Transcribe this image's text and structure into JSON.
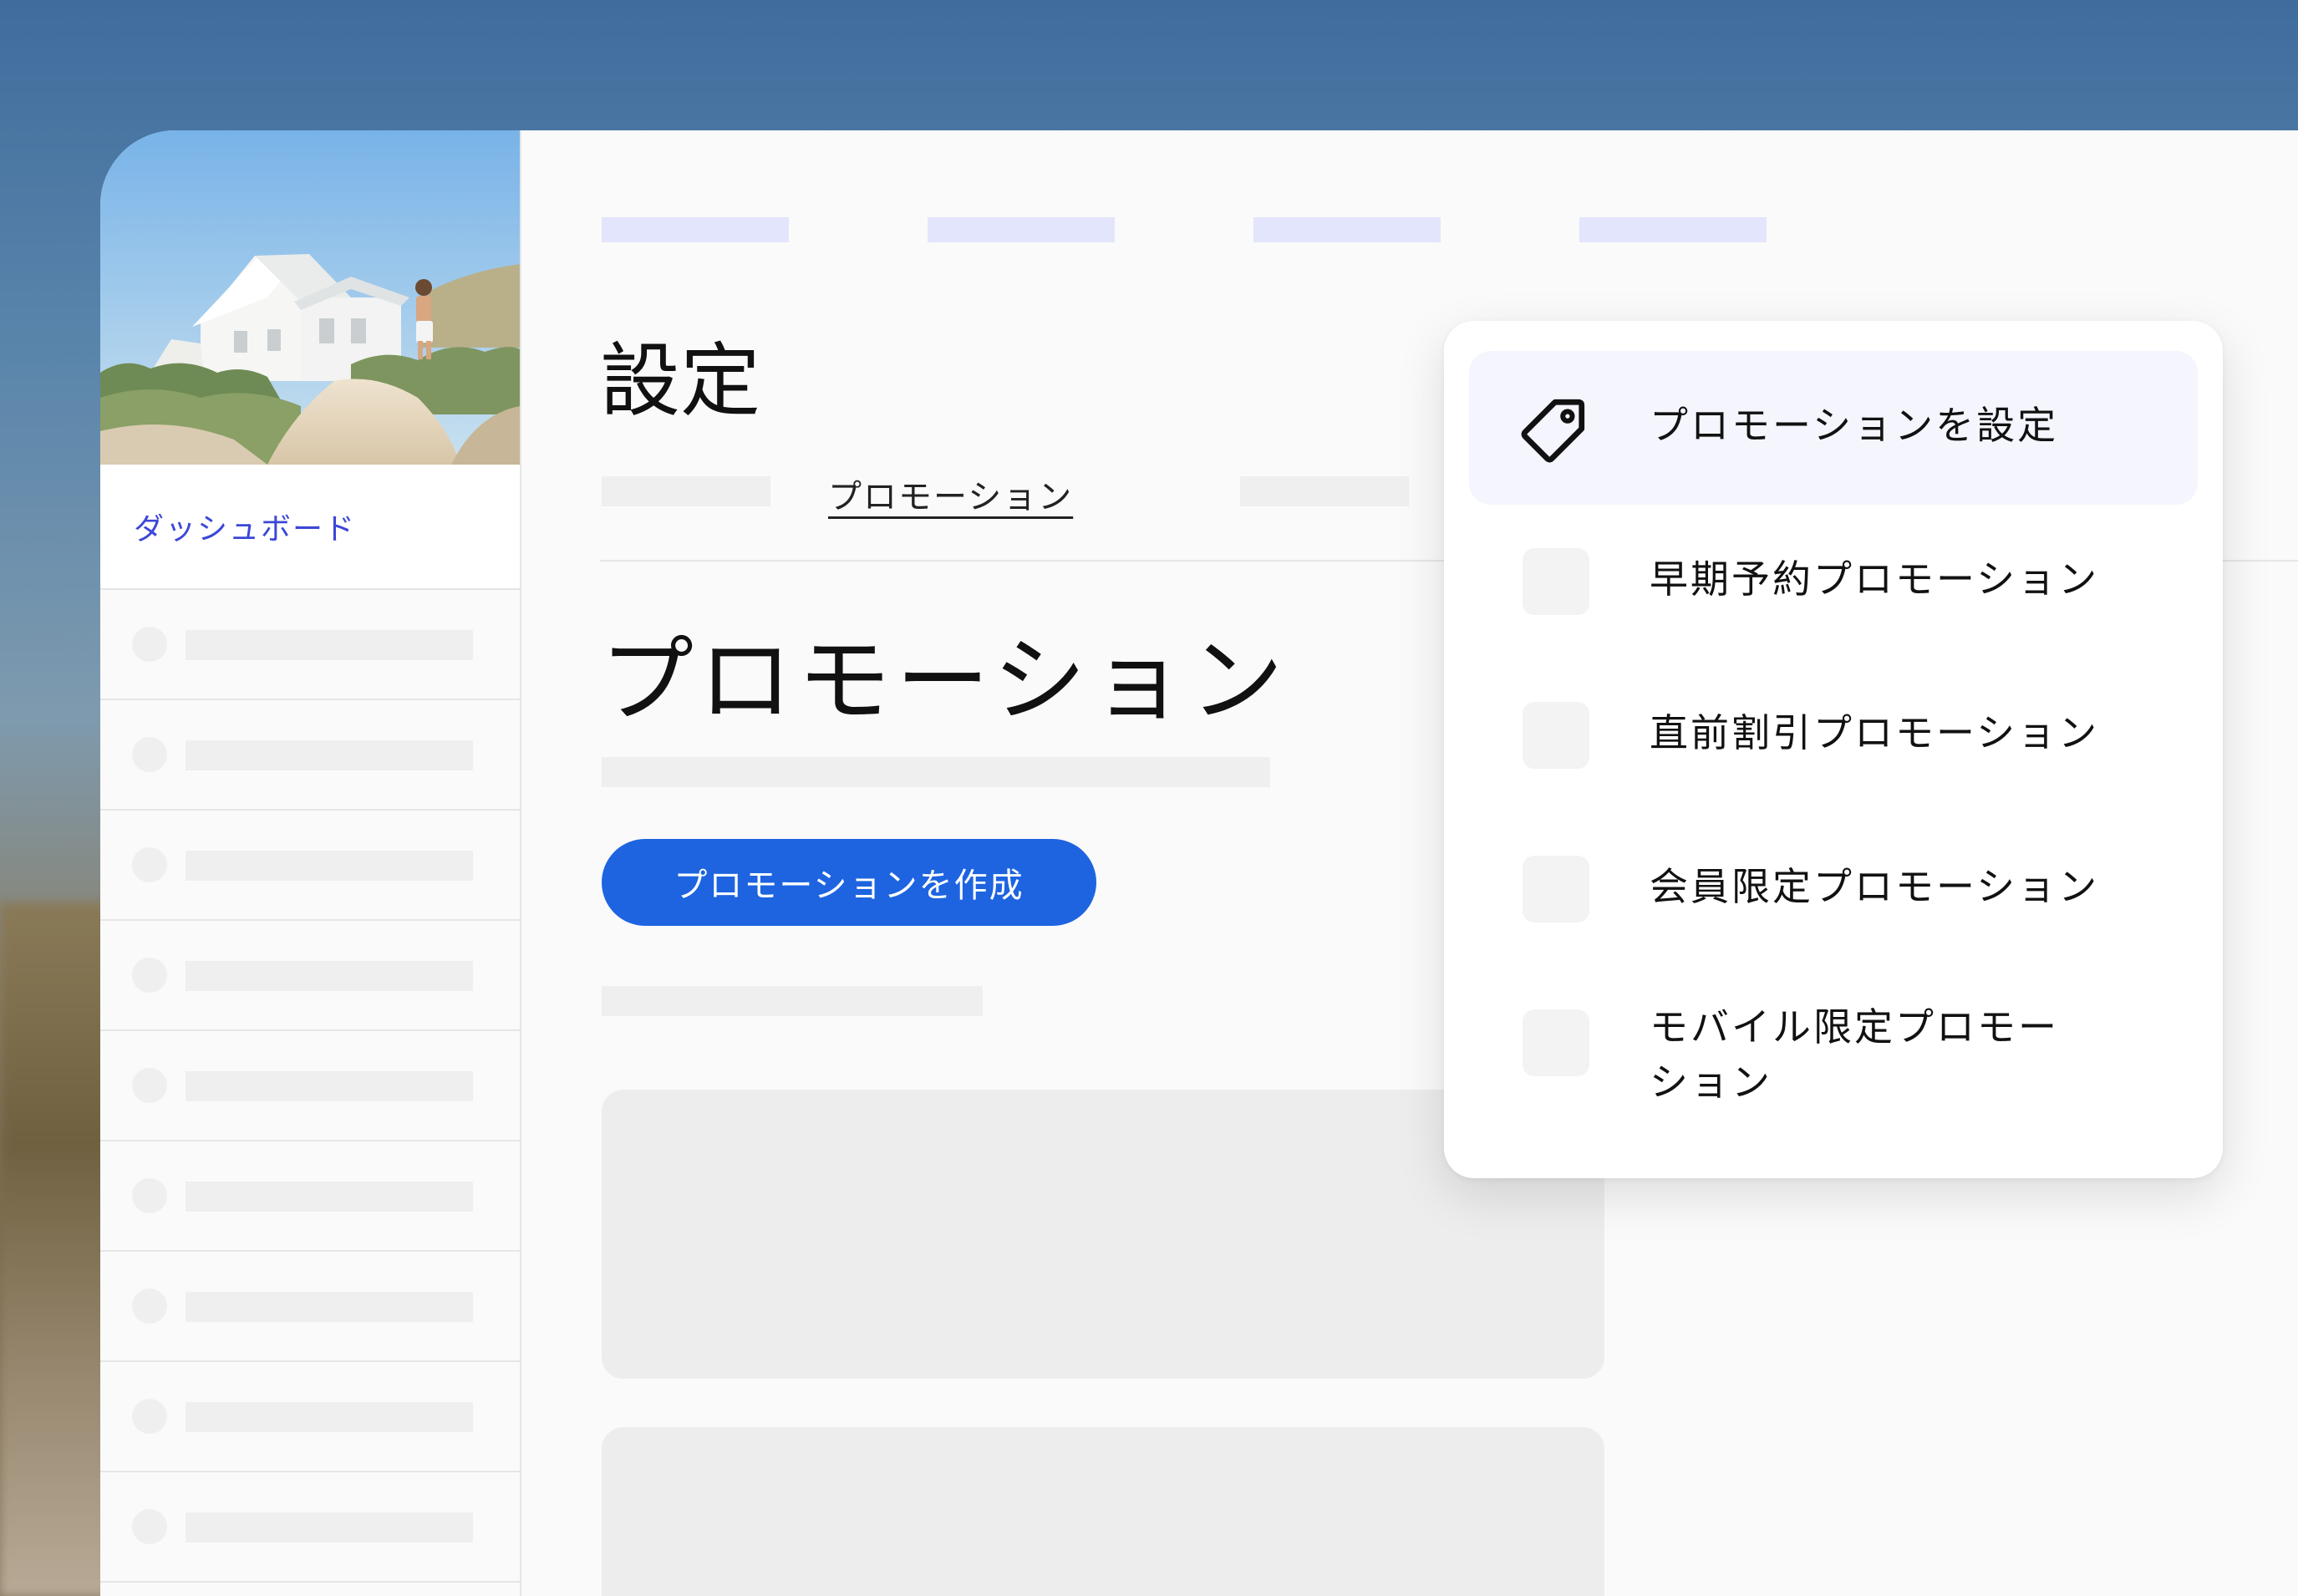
{
  "sidebar": {
    "dashboard_label": "ダッシュボード"
  },
  "main": {
    "settings_title": "設定",
    "active_tab": "プロモーション",
    "section_title": "プロモーション",
    "create_button": "プロモーションを作成"
  },
  "dropdown": {
    "items": [
      {
        "label": "プロモーションを設定",
        "icon": "tag-icon",
        "active": true
      },
      {
        "label": "早期予約プロモーション"
      },
      {
        "label": "直前割引プロモーション"
      },
      {
        "label": "会員限定プロモーション"
      },
      {
        "label": "モバイル限定プロモーション"
      }
    ]
  },
  "colors": {
    "accent": "#1e64e0",
    "link": "#3b47d6",
    "nav_placeholder": "#e2e5fb",
    "active_item_bg": "#f4f5fd"
  }
}
